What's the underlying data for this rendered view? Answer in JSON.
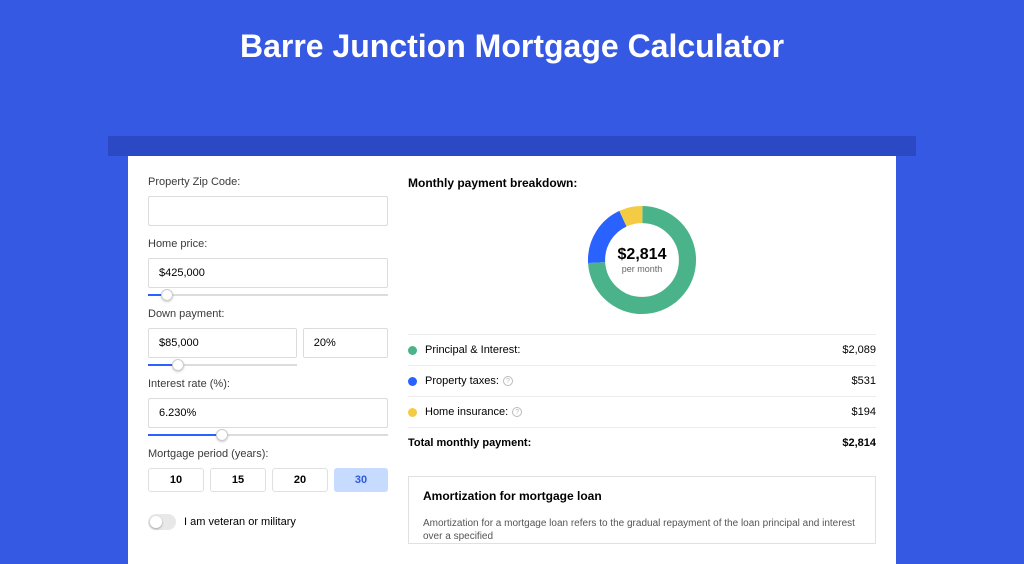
{
  "page_title": "Barre Junction Mortgage Calculator",
  "form": {
    "zip_label": "Property Zip Code:",
    "zip_value": "",
    "price_label": "Home price:",
    "price_value": "$425,000",
    "price_slider_pct": 8,
    "dp_label": "Down payment:",
    "dp_value": "$85,000",
    "dp_pct_value": "20%",
    "dp_slider_pct": 20,
    "rate_label": "Interest rate (%):",
    "rate_value": "6.230%",
    "rate_slider_pct": 31,
    "period_label": "Mortgage period (years):",
    "period_options": [
      "10",
      "15",
      "20",
      "30"
    ],
    "period_selected": "30",
    "vet_label": "I am veteran or military"
  },
  "breakdown": {
    "title": "Monthly payment breakdown:",
    "total_amount": "$2,814",
    "total_sub": "per month",
    "items": [
      {
        "color": "#4ab38a",
        "label": "Principal & Interest:",
        "value": "$2,089",
        "info": false,
        "pct": 74
      },
      {
        "color": "#2962ff",
        "label": "Property taxes:",
        "value": "$531",
        "info": true,
        "pct": 19
      },
      {
        "color": "#f3cc44",
        "label": "Home insurance:",
        "value": "$194",
        "info": true,
        "pct": 7
      }
    ],
    "total_label": "Total monthly payment:",
    "total_value": "$2,814"
  },
  "amort": {
    "title": "Amortization for mortgage loan",
    "body": "Amortization for a mortgage loan refers to the gradual repayment of the loan principal and interest over a specified"
  },
  "chart_data": {
    "type": "pie",
    "title": "Monthly payment breakdown",
    "categories": [
      "Principal & Interest",
      "Property taxes",
      "Home insurance"
    ],
    "values": [
      2089,
      531,
      194
    ],
    "total": 2814,
    "colors": [
      "#4ab38a",
      "#2962ff",
      "#f3cc44"
    ]
  }
}
